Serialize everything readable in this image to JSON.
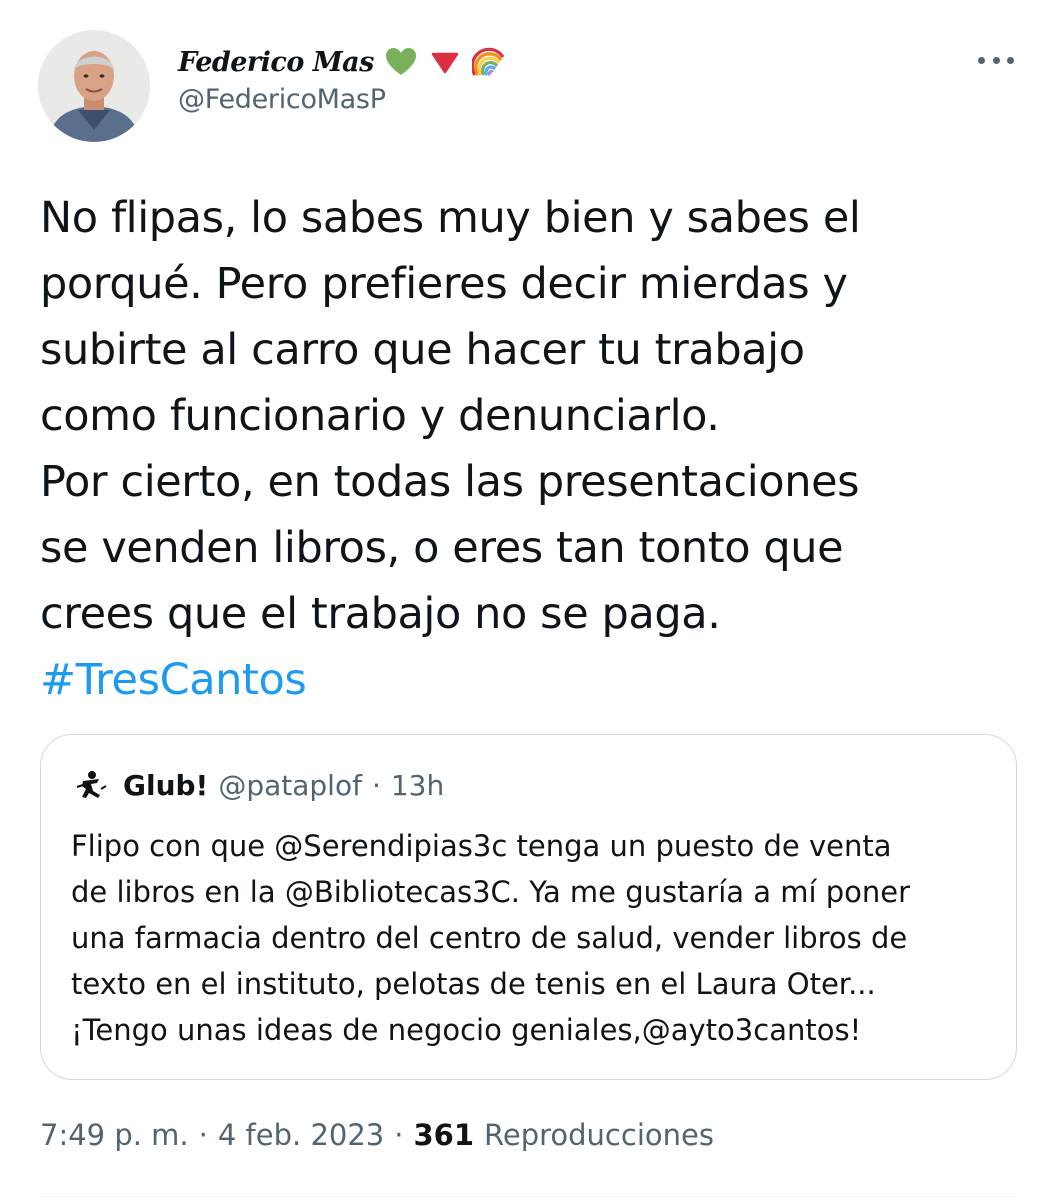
{
  "author": {
    "name": "Federico Mas",
    "handle": "@FedericoMasP",
    "emojis": [
      "green-heart-icon",
      "red-triangle-icon",
      "rainbow-icon"
    ]
  },
  "tweet": {
    "lines": [
      "No flipas, lo sabes muy bien y sabes el",
      "porqué. Pero prefieres decir mierdas y",
      "subirte al carro que hacer tu trabajo",
      "como funcionario y denunciarlo.",
      "Por cierto, en todas las presentaciones",
      "se venden libros, o eres tan tonto que",
      "crees que el trabajo no se paga."
    ],
    "hashtag": "#TresCantos"
  },
  "quote": {
    "name": "Glub!",
    "handle": "@pataplof",
    "separator": "·",
    "time": "13h",
    "lines": [
      "Flipo con que @Serendipias3c tenga un puesto de venta",
      "de libros en la @Bibliotecas3C. Ya me gustaría a mí poner",
      "una farmacia dentro del centro de salud, vender libros de",
      "texto en el instituto, pelotas de tenis en el Laura Oter...",
      "¡Tengo unas ideas de negocio geniales,@ayto3cantos!"
    ]
  },
  "meta": {
    "time": "7:49 p. m.",
    "separator": "·",
    "date": "4 feb. 2023",
    "views_count": "361",
    "views_label": "Reproducciones"
  },
  "colors": {
    "text": "#0f1419",
    "secondary": "#536471",
    "link": "#1d9bf0",
    "border": "#cfd9de"
  }
}
